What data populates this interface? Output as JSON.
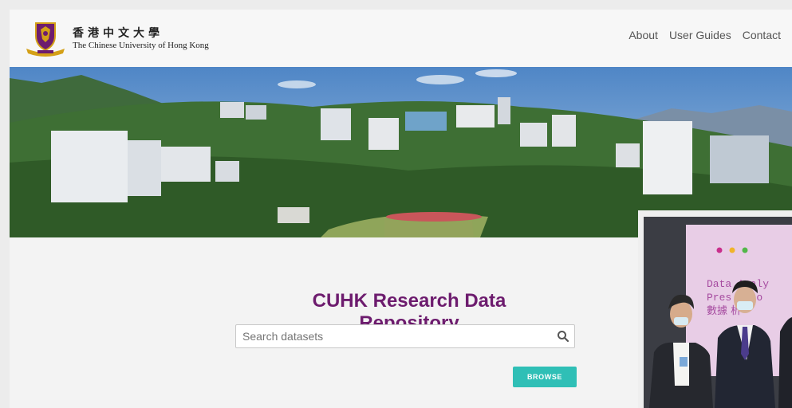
{
  "header": {
    "logo_zh": "香港中文大學",
    "logo_en": "The Chinese University of Hong Kong",
    "nav": [
      "About",
      "User Guides",
      "Contact"
    ]
  },
  "main": {
    "title": "CUHK Research Data Repository",
    "search_placeholder": "Search datasets",
    "browse_label": "BROWSE"
  },
  "video": {
    "slide_line1": "Data Analy",
    "slide_line2": "Pres  atio",
    "slide_line3": "數據  析"
  },
  "colors": {
    "title": "#6d1c6e",
    "browse": "#2fbfb6",
    "crest_purple": "#6d1c6e",
    "crest_gold": "#d4a017"
  }
}
